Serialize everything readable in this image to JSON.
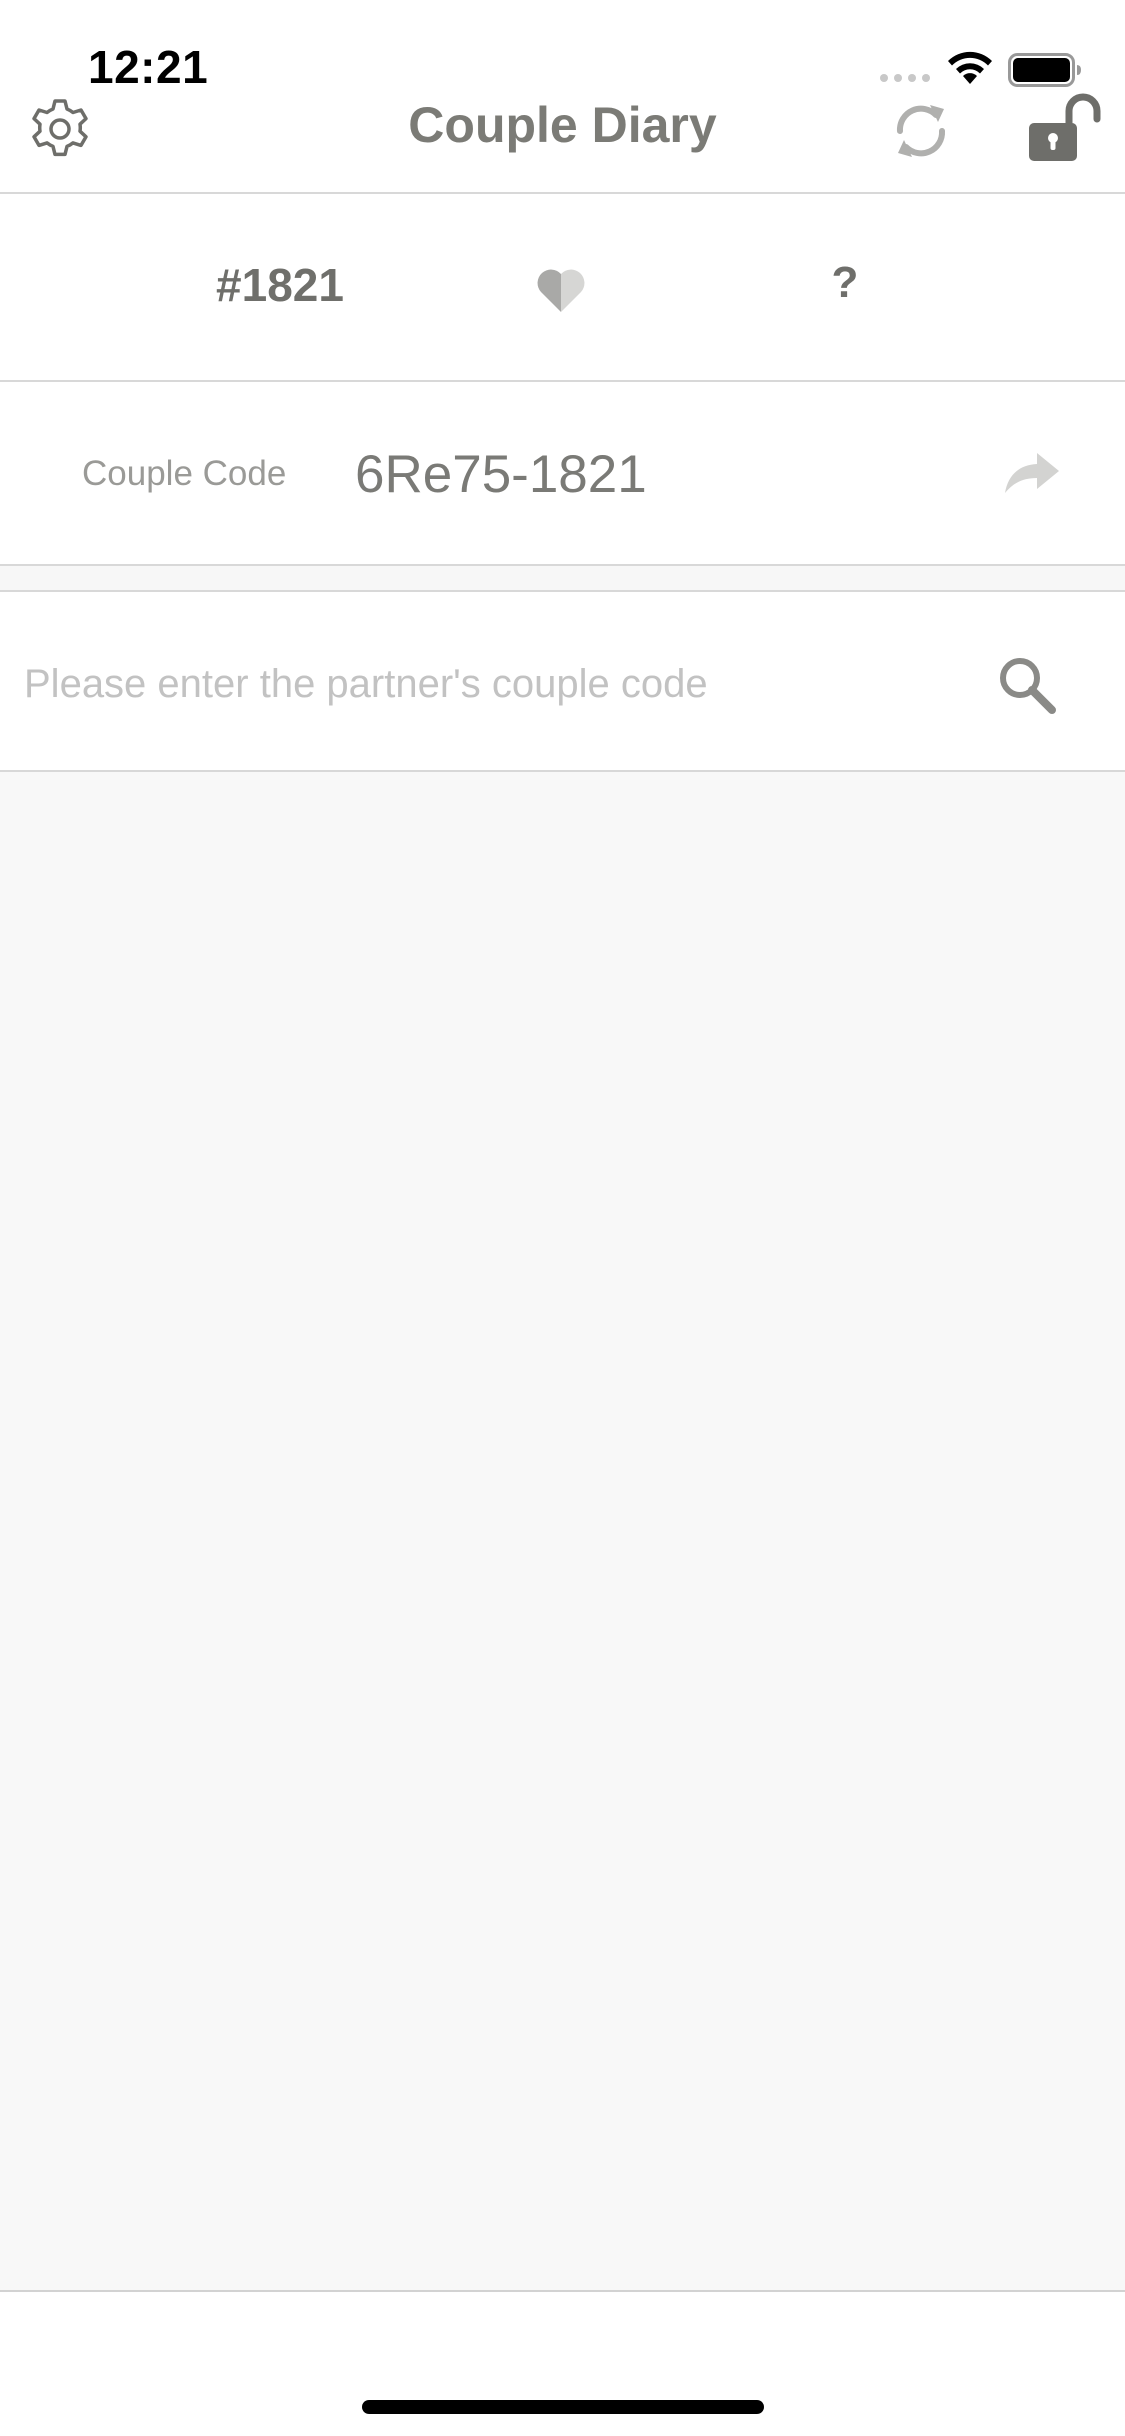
{
  "status_bar": {
    "time": "12:21",
    "icons": [
      "cellular-dots-icon",
      "wifi-icon",
      "battery-icon"
    ]
  },
  "nav": {
    "title": "Couple Diary",
    "left_icon": "gear-icon",
    "right_icons": [
      "sync-icon",
      "unlock-icon"
    ]
  },
  "couple": {
    "my_number": "#1821",
    "partner_number": "?",
    "link_icon": "half-heart-icon"
  },
  "code": {
    "label": "Couple Code",
    "value": "6Re75-1821",
    "share_icon": "share-arrow-icon"
  },
  "search": {
    "placeholder": "Please enter the partner's couple code",
    "value": "",
    "icon": "search-icon"
  },
  "colors": {
    "title_gray": "#7b7b76",
    "divider": "#d8d8d8",
    "content_background": "#f8f8f8",
    "icon_gray": "#6e6e6a"
  }
}
